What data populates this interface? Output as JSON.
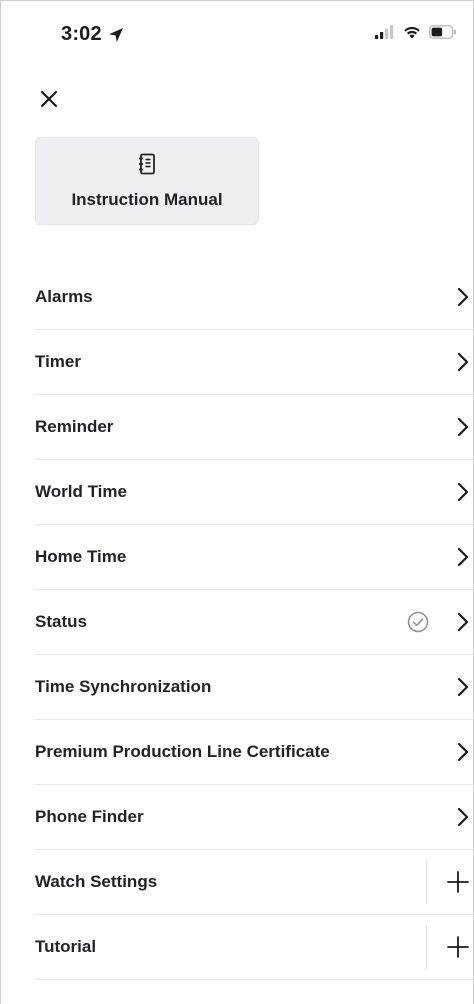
{
  "status_bar": {
    "time": "3:02"
  },
  "icons": {
    "close": "close-icon",
    "manual": "notebook-icon",
    "chevron": "chevron-right-icon",
    "check": "check-circle-icon",
    "plus": "plus-icon",
    "location": "location-arrow-icon",
    "signal": "cellular-signal-icon",
    "wifi": "wifi-icon",
    "battery": "battery-icon"
  },
  "manual_card": {
    "label": "Instruction Manual"
  },
  "menu": {
    "items": [
      {
        "label": "Alarms",
        "accessory": "chevron"
      },
      {
        "label": "Timer",
        "accessory": "chevron"
      },
      {
        "label": "Reminder",
        "accessory": "chevron"
      },
      {
        "label": "World Time",
        "accessory": "chevron"
      },
      {
        "label": "Home Time",
        "accessory": "chevron"
      },
      {
        "label": "Status",
        "accessory": "chevron",
        "status_checked": true
      },
      {
        "label": "Time Synchronization",
        "accessory": "chevron"
      },
      {
        "label": "Premium Production Line Certificate",
        "accessory": "chevron"
      },
      {
        "label": "Phone Finder",
        "accessory": "chevron"
      },
      {
        "label": "Watch Settings",
        "accessory": "plus"
      },
      {
        "label": "Tutorial",
        "accessory": "plus"
      }
    ]
  },
  "colors": {
    "text": "#1f2328",
    "card_bg": "#eef0f3",
    "divider": "#e6e6e6",
    "muted_icon": "#8e8e93"
  }
}
